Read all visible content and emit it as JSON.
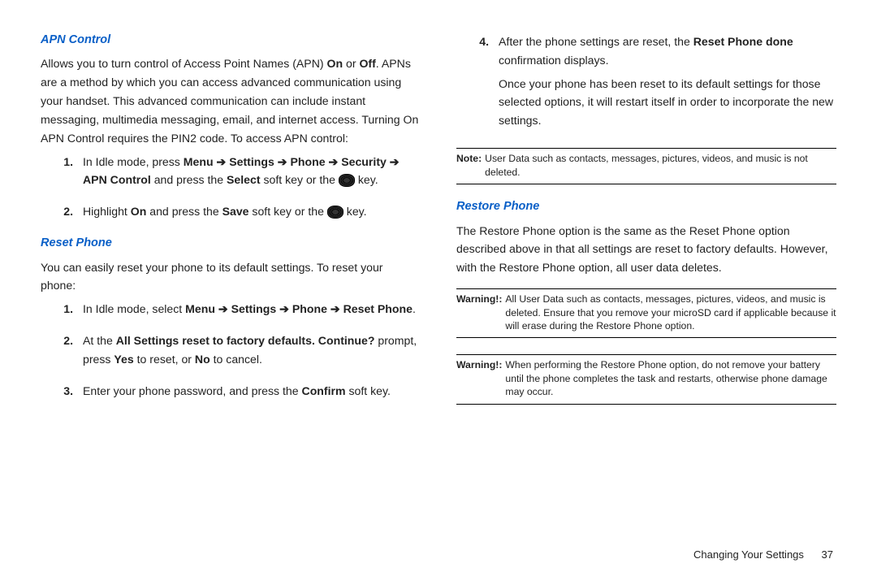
{
  "left": {
    "apn_heading": "APN Control",
    "apn_para_pre": "Allows you to turn control of Access Point Names (APN) ",
    "apn_para_on": "On",
    "apn_para_or": " or ",
    "apn_para_off": "Off",
    "apn_para_post": ". APNs are a method by which you can access advanced communication using your handset. This advanced communication can include instant messaging, multimedia messaging, email, and internet access. Turning On APN Control requires the PIN2 code. To access APN control:",
    "apn_step1_pre": "In Idle mode, press ",
    "apn_step1_menu": "Menu",
    "apn_step1_settings": "Settings",
    "apn_step1_phone": "Phone",
    "apn_step1_security": "Security",
    "apn_step1_apncontrol": "APN Control",
    "apn_step1_mid": " and press the ",
    "apn_step1_select": "Select",
    "apn_step1_soft": " soft key or the ",
    "apn_step1_key": " key.",
    "apn_step2_pre": "Highlight ",
    "apn_step2_on": "On",
    "apn_step2_mid": " and press the ",
    "apn_step2_save": "Save",
    "apn_step2_soft": " soft key or the ",
    "apn_step2_key": " key.",
    "reset_heading": "Reset Phone",
    "reset_para": "You can easily reset your phone to its default settings. To reset your phone:",
    "reset_step1_pre": "In Idle mode, select ",
    "reset_step1_menu": "Menu",
    "reset_step1_settings": "Settings",
    "reset_step1_phone": "Phone",
    "reset_step1_reset": "Reset Phone",
    "reset_step1_end": ".",
    "reset_step2_pre": "At the ",
    "reset_step2_prompt": "All Settings reset to factory defaults. Continue?",
    "reset_step2_mid": " prompt, press ",
    "reset_step2_yes": "Yes",
    "reset_step2_mid2": " to reset, or ",
    "reset_step2_no": "No",
    "reset_step2_end": " to cancel.",
    "reset_step3_pre": "Enter your phone password, and press the ",
    "reset_step3_confirm": "Confirm",
    "reset_step3_end": " soft key."
  },
  "right": {
    "step4_num": "4.",
    "step4_pre": "After the phone settings are reset, the ",
    "step4_bold": "Reset Phone done",
    "step4_mid": " confirmation displays.",
    "step4_para2": "Once your phone has been reset to its default settings for those selected options, it will restart itself in order to incorporate the new settings.",
    "note1_label": "Note:",
    "note1_text": "User Data such as contacts, messages, pictures, videos, and music is not deleted.",
    "restore_heading": "Restore Phone",
    "restore_para": "The Restore Phone option is the same as the Reset Phone option described above in that all settings are reset to factory defaults. However, with the Restore Phone option, all user data deletes.",
    "warn1_label": "Warning!:",
    "warn1_text": "All User Data such as contacts, messages, pictures, videos, and music is deleted. Ensure that you remove your microSD card if applicable because it will erase during the Restore Phone option.",
    "warn2_label": "Warning!:",
    "warn2_text": "When performing the Restore Phone option, do not remove your battery until the phone completes the task and restarts, otherwise phone damage may occur."
  },
  "footer": {
    "section": "Changing Your Settings",
    "page": "37"
  },
  "arrow": "➔"
}
